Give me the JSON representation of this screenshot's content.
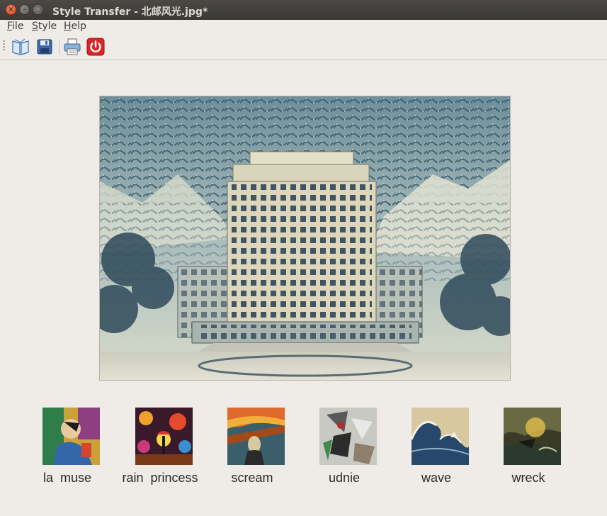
{
  "window": {
    "title": "Style Transfer - 北邮风光.jpg*"
  },
  "menubar": {
    "items": [
      {
        "name": "file",
        "mnemonic": "F",
        "rest": "ile"
      },
      {
        "name": "style",
        "mnemonic": "S",
        "rest": "tyle"
      },
      {
        "name": "help",
        "mnemonic": "H",
        "rest": "elp"
      }
    ]
  },
  "toolbar": {
    "icons": [
      "open-book-icon",
      "save-icon",
      "print-icon",
      "power-icon"
    ]
  },
  "styles": [
    {
      "label": "la  muse",
      "icon": "la-muse-thumbnail"
    },
    {
      "label": "rain  princess",
      "icon": "rain-princess-thumbnail"
    },
    {
      "label": "scream",
      "icon": "scream-thumbnail"
    },
    {
      "label": "udnie",
      "icon": "udnie-thumbnail"
    },
    {
      "label": "wave",
      "icon": "wave-thumbnail"
    },
    {
      "label": "wreck",
      "icon": "wreck-thumbnail"
    }
  ],
  "colors": {
    "window_bg": "#efebe7",
    "titlebar": "#3b3a36",
    "close_button": "#dc4c1e"
  }
}
